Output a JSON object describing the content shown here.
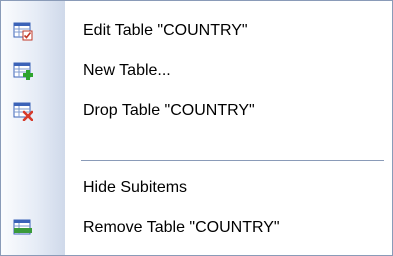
{
  "menu": {
    "items": [
      {
        "label": "Edit Table \"COUNTRY\"",
        "icon": "edit-table-icon"
      },
      {
        "label": "New Table...",
        "icon": "new-table-icon"
      },
      {
        "label": "Drop Table \"COUNTRY\"",
        "icon": "drop-table-icon"
      },
      {
        "label": "Hide Subitems",
        "icon": ""
      },
      {
        "label": "Remove Table \"COUNTRY\"",
        "icon": "remove-table-icon"
      }
    ]
  },
  "colors": {
    "border": "#8a9bb8",
    "gutter_start": "#fbfcfe",
    "gutter_end": "#cfd9ea",
    "table_blue": "#3b63b8",
    "add_green": "#2ea42e",
    "delete_red": "#d73a2a",
    "remove_green": "#3a9a3a"
  }
}
